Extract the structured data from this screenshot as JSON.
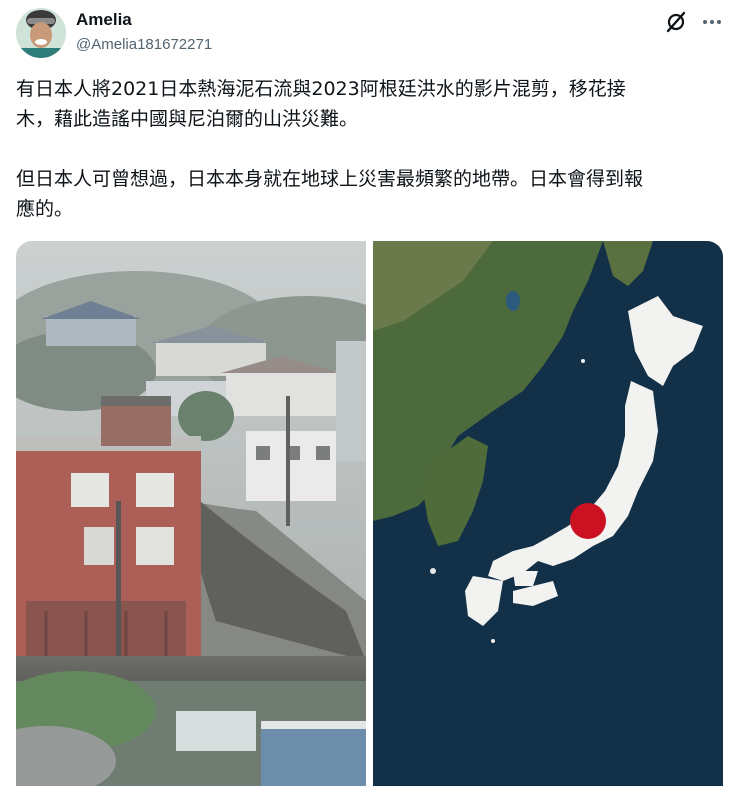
{
  "user": {
    "display_name": "Amelia",
    "handle": "@Amelia181672271"
  },
  "tweet": {
    "paragraph_1_line_1": "有日本人將2021日本熱海泥石流與2023阿根廷洪水的影片混剪，移花接",
    "paragraph_1_line_2": "木，藉此造謠中國與尼泊爾的山洪災難。",
    "paragraph_2_line_1": "但日本人可曾想過，日本本身就在地球上災害最頻繁的地帶。日本會得到報",
    "paragraph_2_line_2": "應的。"
  },
  "icons": {
    "header_actions": [
      "grok-icon",
      "more-icon"
    ]
  },
  "colors": {
    "text_primary": "#0f1419",
    "text_secondary": "#536471",
    "japan_flag_red": "#cc1122",
    "ocean": "#123048"
  }
}
